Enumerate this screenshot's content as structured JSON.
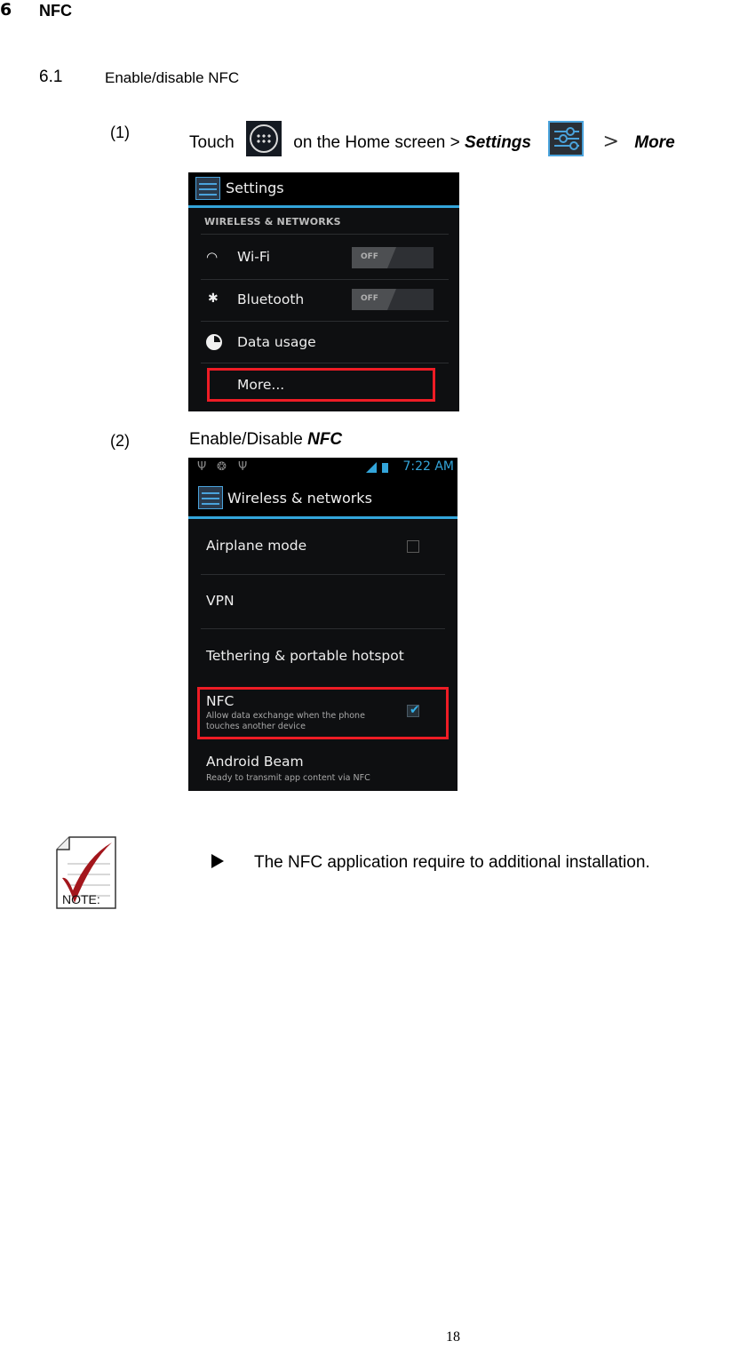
{
  "heading": {
    "number": "6",
    "title": "NFC"
  },
  "subheading": {
    "number": "6.1",
    "title": "Enable/disable NFC"
  },
  "steps": [
    {
      "number": "(1)",
      "text_before": "Touch",
      "icon1": "apps-launcher-icon",
      "text_middle": "on the Home screen >",
      "bold_1": "Settings",
      "icon2": "settings-icon",
      "separator": ">",
      "bold_2": "More"
    },
    {
      "number": "(2)",
      "text_before": "Enable/Disable",
      "bold_1": "NFC"
    }
  ],
  "screenshot1": {
    "title": "Settings",
    "section": "WIRELESS & NETWORKS",
    "items": [
      {
        "label": "Wi-Fi",
        "icon": "wifi-icon",
        "toggle": "OFF"
      },
      {
        "label": "Bluetooth",
        "icon": "bluetooth-icon",
        "toggle": "OFF"
      },
      {
        "label": "Data usage",
        "icon": "data-usage-icon"
      },
      {
        "label": "More...",
        "highlighted": true
      }
    ]
  },
  "screenshot2": {
    "status_time": "7:22 AM",
    "title": "Wireless & networks",
    "items": [
      {
        "label": "Airplane mode",
        "checked": false
      },
      {
        "label": "VPN"
      },
      {
        "label": "Tethering & portable hotspot"
      },
      {
        "label": "NFC",
        "sub": "Allow data exchange when the phone touches another device",
        "checked": true,
        "highlighted": true
      },
      {
        "label": "Android Beam",
        "sub": "Ready to transmit app content via NFC"
      }
    ]
  },
  "note": {
    "label": "NOTE:",
    "text": "The NFC application require to additional installation."
  },
  "page_number": "18",
  "colors": {
    "accent_blue": "#33a5da",
    "highlight_red": "#ee1c25",
    "check_red": "#a3161c"
  }
}
